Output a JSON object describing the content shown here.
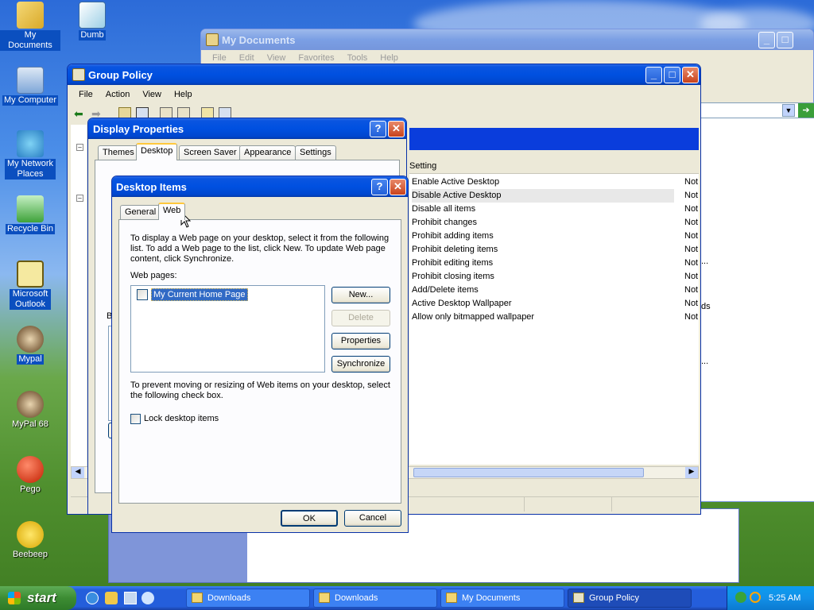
{
  "desktop": {
    "icons": [
      {
        "label": "My Documents",
        "icon": "my-documents-icon"
      },
      {
        "label": "Dumb",
        "icon": "dumb-icon"
      },
      {
        "label": "My Computer",
        "icon": "my-computer-icon"
      },
      {
        "label": "My Network Places",
        "icon": "network-places-icon"
      },
      {
        "label": "Recycle Bin",
        "icon": "recycle-bin-icon"
      },
      {
        "label": "Microsoft Outlook",
        "icon": "outlook-icon"
      },
      {
        "label": "Mypal",
        "icon": "mypal-icon"
      },
      {
        "label": "MyPal 68",
        "icon": "mypal68-icon"
      },
      {
        "label": "Pego",
        "icon": "pego-icon"
      },
      {
        "label": "Beebeep",
        "icon": "beebeep-icon"
      }
    ]
  },
  "my_documents_window": {
    "title": "My Documents",
    "menu": [
      "File",
      "Edit",
      "View",
      "Favorites",
      "Tools",
      "Help"
    ]
  },
  "group_policy_window": {
    "title": "Group Policy",
    "menu": [
      "File",
      "Action",
      "View",
      "Help"
    ],
    "column_setting": "Setting",
    "rows": [
      {
        "name": "Enable Active Desktop",
        "state": "Not"
      },
      {
        "name": "Disable Active Desktop",
        "state": "Not"
      },
      {
        "name": "Disable all items",
        "state": "Not"
      },
      {
        "name": "Prohibit changes",
        "state": "Not"
      },
      {
        "name": "Prohibit adding items",
        "state": "Not"
      },
      {
        "name": "Prohibit deleting items",
        "state": "Not"
      },
      {
        "name": "Prohibit editing items",
        "state": "Not"
      },
      {
        "name": "Prohibit closing items",
        "state": "Not"
      },
      {
        "name": "Add/Delete items",
        "state": "Not"
      },
      {
        "name": "Active Desktop Wallpaper",
        "state": "Not"
      },
      {
        "name": "Allow only bitmapped wallpaper",
        "state": "Not"
      }
    ],
    "trailing_fragments": [
      "...",
      "ds",
      "..."
    ]
  },
  "display_properties": {
    "title": "Display Properties",
    "tabs": [
      "Themes",
      "Desktop",
      "Screen Saver",
      "Appearance",
      "Settings"
    ],
    "selected_tab": "Desktop",
    "fragment_letter": "B"
  },
  "desktop_items": {
    "title": "Desktop Items",
    "tabs": [
      "General",
      "Web"
    ],
    "selected_tab": "Web",
    "intro_text": "To display a Web page on your desktop, select it from the following list. To add a Web page to the list, click New.  To update Web page content, click Synchronize.",
    "web_pages_label": "Web pages:",
    "web_pages": [
      {
        "name": "My Current Home Page",
        "checked": false,
        "selected": true
      }
    ],
    "buttons": {
      "new": "New...",
      "delete": "Delete",
      "properties": "Properties",
      "synchronize": "Synchronize"
    },
    "lock_text": "To prevent moving or resizing of Web items on your desktop, select the following check box.",
    "lock_label": "Lock desktop items",
    "lock_checked": false,
    "ok": "OK",
    "cancel": "Cancel"
  },
  "taskbar": {
    "start_label": "start",
    "items": [
      "Downloads",
      "Downloads",
      "My Documents",
      "Group Policy"
    ],
    "clock": "5:25 AM"
  },
  "colors": {
    "titlebar_active": "#0050e0",
    "selection": "#316ac5",
    "tab_highlight": "#ffc83c"
  }
}
